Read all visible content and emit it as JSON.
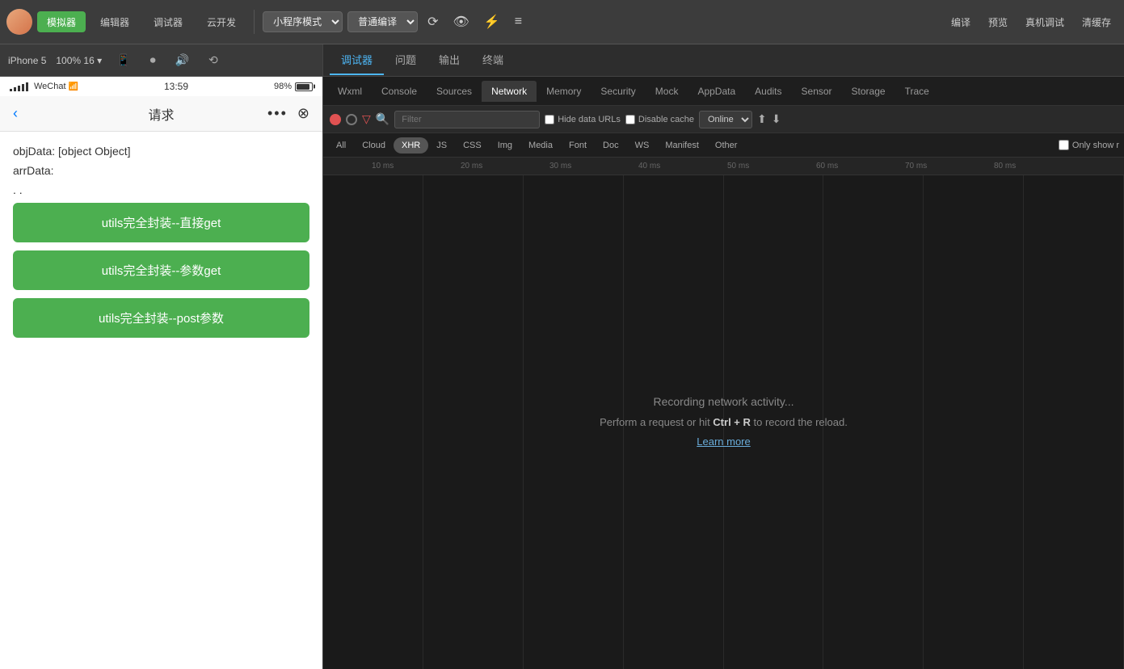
{
  "toolbar": {
    "mode_label": "小程序模式",
    "translate_label": "普通编译",
    "compile_label": "编译",
    "preview_label": "预览",
    "device_label": "真机调试",
    "clear_label": "清缓存",
    "sim_label": "模拟器",
    "editor_label": "编辑器",
    "debug_label": "调试器",
    "cloud_label": "云开发"
  },
  "phone": {
    "device_label": "iPhone 5",
    "zoom_label": "100%",
    "zoom_level": "16",
    "status_time": "13:59",
    "status_battery": "98%",
    "wechat_label": "WeChat",
    "nav_title": "请求",
    "obj_data_label": "objData: [object Object]",
    "arr_data_label": "arrData:",
    "arr_dots": ". .",
    "btn1_label": "utils完全封装--直接get",
    "btn2_label": "utils完全封装--参数get",
    "btn3_label": "utils完全封装--post参数"
  },
  "devtools": {
    "tab_debug": "调试器",
    "tab_issues": "问题",
    "tab_output": "输出",
    "tab_terminal": "终端",
    "subtabs": [
      "Wxml",
      "Console",
      "Sources",
      "Network",
      "Memory",
      "Security",
      "Mock",
      "AppData",
      "Audits",
      "Sensor",
      "Storage",
      "Trace"
    ],
    "active_subtab": "Network",
    "network": {
      "filter_placeholder": "Filter",
      "hide_data_urls_label": "Hide data URLs",
      "disable_cache_label": "Disable cache",
      "online_label": "Online",
      "type_tabs": [
        "All",
        "Cloud",
        "XHR",
        "JS",
        "CSS",
        "Img",
        "Media",
        "Font",
        "Doc",
        "WS",
        "Manifest",
        "Other"
      ],
      "active_type_tab": "XHR",
      "only_show_label": "Only show r",
      "ruler_marks": [
        "10 ms",
        "20 ms",
        "30 ms",
        "40 ms",
        "50 ms",
        "60 ms",
        "70 ms",
        "80 ms"
      ],
      "empty_title": "Recording network activity...",
      "empty_desc_before": "Perform a request or hit ",
      "empty_ctrl": "Ctrl + R",
      "empty_desc_after": " to record the reload.",
      "learn_more": "Learn more"
    }
  }
}
